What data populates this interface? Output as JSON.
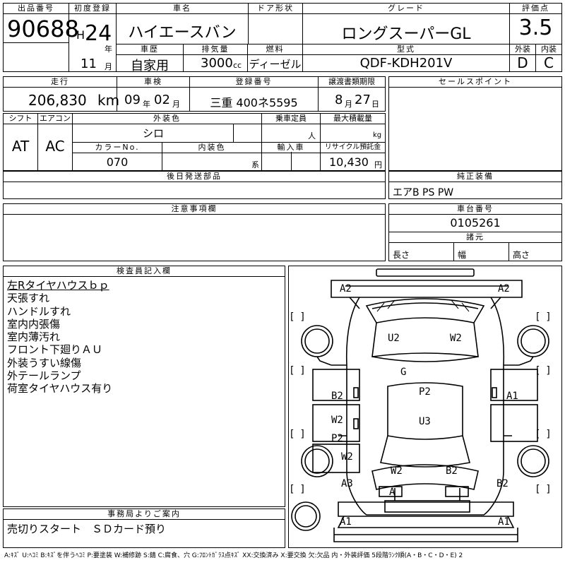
{
  "header": {
    "lot_no_label": "出品番号",
    "lot_no": "90688",
    "first_reg_label": "初度登録",
    "era": "H",
    "year": "24",
    "year_unit": "年",
    "month": "11",
    "month_unit": "月",
    "car_name_label": "車名",
    "car_name": "ハイエースバン",
    "door_label": "ドア形状",
    "door": "",
    "grade_label": "グレード",
    "grade": "ロングスーパーGL",
    "score_label": "評価点",
    "score": "3.5",
    "history_label": "車歴",
    "history": "自家用",
    "displacement_label": "排気量",
    "displacement": "3000",
    "displacement_unit": "cc",
    "fuel_label": "燃料",
    "fuel": "ディーゼル",
    "model_label": "型式",
    "model": "QDF-KDH201V",
    "exterior_label": "外装",
    "exterior": "D",
    "interior_label": "内装",
    "interior": "C"
  },
  "row2": {
    "mileage_label": "走行",
    "mileage": "206,830",
    "mileage_unit": "km",
    "inspection_label": "車検",
    "inspection_year": "09",
    "inspection_year_unit": "年",
    "inspection_month": "02",
    "inspection_month_unit": "月",
    "plate_label": "登録番号",
    "plate": "三重 400ネ5595",
    "transfer_label": "譲渡書類期限",
    "transfer_month": "8",
    "transfer_month_unit": "月",
    "transfer_day": "27",
    "transfer_day_unit": "日",
    "sales_point_label": "セールスポイント"
  },
  "row3": {
    "shift_label": "シフト",
    "shift": "AT",
    "ac_label": "エアコン",
    "ac": "AC",
    "ext_color_label": "外装色",
    "ext_color": "シロ",
    "capacity_label": "乗車定員",
    "capacity_unit": "人",
    "max_load_label": "最大積載量",
    "max_load_unit": "kg",
    "color_no_label": "カラーNo.",
    "color_no": "070",
    "int_color_label": "内装色",
    "int_color_unit": "系",
    "import_label": "輸入車",
    "recycle_label": "リサイクル預託金",
    "recycle": "10,430",
    "recycle_unit": "円"
  },
  "later_parts_label": "後日発送部品",
  "genuine_equipment_label": "純正装備",
  "genuine_equipment": "エアB PS PW",
  "notes_label": "注意事項欄",
  "chassis_label": "車台番号",
  "chassis_no": "0105261",
  "dims_label": "諸元",
  "length_label": "長さ",
  "width_label": "幅",
  "height_label": "高さ",
  "inspector_label": "検査員記入欄",
  "inspector_notes": [
    "左Rタイヤハウスｂｐ",
    "天張すれ",
    "ハンドルすれ",
    "室内内張傷",
    "室内薄汚れ",
    "フロント下廻りＡＵ",
    "外装うすい線傷",
    "外テールランプ",
    "荷室タイヤハウス有り"
  ],
  "office_label": "事務局よりご案内",
  "office_notice": "売切りスタート　ＳＤカード預り",
  "diagram": {
    "labels": {
      "front_left": "A2",
      "front_right": "A2",
      "roof1": "U2",
      "roof2": "W2",
      "glass": "G",
      "left_b2": "B2",
      "right_a1": "A1",
      "center_p2": "P2",
      "center_u3": "U3",
      "left_w2": "W2",
      "left_p2": "P2",
      "left_w2b": "W2",
      "rear_w2": "W2",
      "rear_b2": "B2",
      "left_a3": "A3",
      "rear_a": "A",
      "right_b2": "B2",
      "bottom_a1_left": "A1",
      "bottom_a1_right": "A1"
    }
  },
  "legend": "A:ｷｽﾞ U:ﾍｺﾐ B:ｷｽﾞを伴うﾍｺﾐ P:要塗装 W:補修跡 S:錆 C:腐食、穴 G:ﾌﾛﾝﾄｶﾞﾗｽ点ｷｽﾞ XX:交換済み X:要交換 欠:欠品 内・外装評価 5段階ﾗﾝｸ順(A・B・C・D・E) 2"
}
